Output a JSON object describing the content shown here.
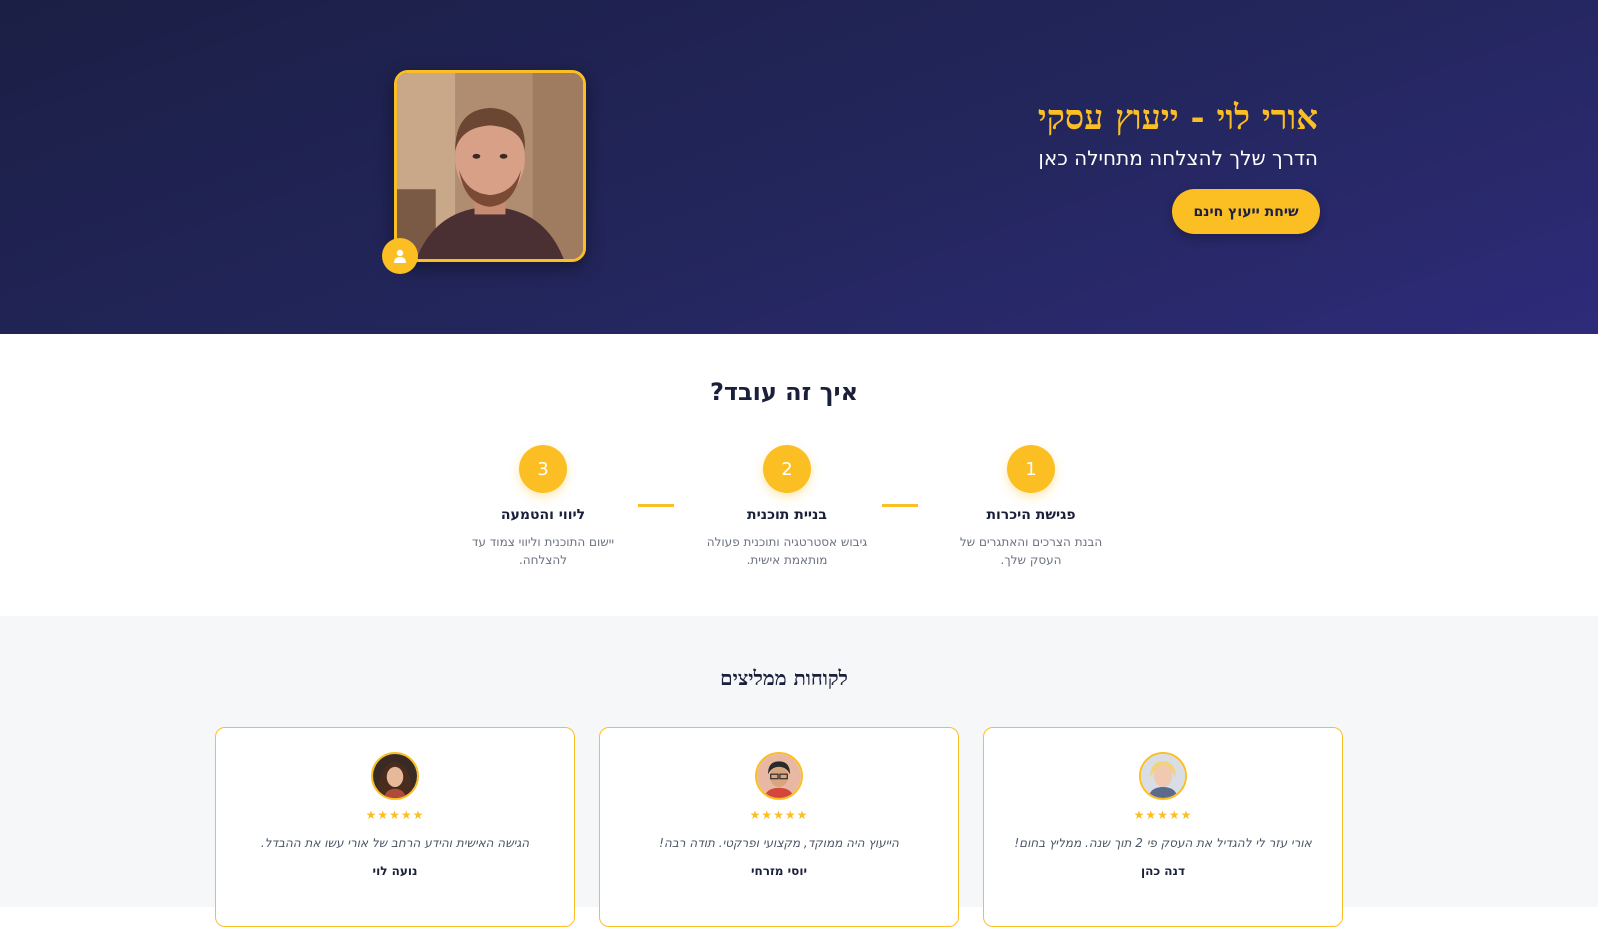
{
  "hero": {
    "title": "אורי לוי - ייעוץ עסקי",
    "subtitle": "הדרך שלך להצלחה מתחילה כאן",
    "cta_label": "שיחת ייעוץ חינם"
  },
  "how_it_works": {
    "title": "איך זה עובד?",
    "steps": [
      {
        "number": "1",
        "title": "פגישת היכרות",
        "description": "הבנת הצרכים והאתגרים של העסק שלך."
      },
      {
        "number": "2",
        "title": "בניית תוכנית",
        "description": "גיבוש אסטרטגיה ותוכנית פעולה מותאמת אישית."
      },
      {
        "number": "3",
        "title": "ליווי והטמעה",
        "description": "יישום התוכנית וליווי צמוד עד להצלחה."
      }
    ]
  },
  "testimonials": {
    "title": "לקוחות ממליצים",
    "items": [
      {
        "stars": "★★★★★",
        "quote": "אורי עזר לי להגדיל את העסק פי 2 תוך שנה. ממליץ בחום!",
        "name": "דנה כהן"
      },
      {
        "stars": "★★★★★",
        "quote": "הייעוץ היה ממוקד, מקצועי ופרקטי. תודה רבה!",
        "name": "יוסי מזרחי"
      },
      {
        "stars": "★★★★★",
        "quote": "הגישה האישית והידע הרחב של אורי עשו את ההבדל.",
        "name": "נועה לוי"
      }
    ]
  },
  "colors": {
    "accent": "#fbbf24",
    "hero_dark": "#1b1f45",
    "hero_light": "#2e2b7a"
  },
  "icons": {
    "profile_badge": "user-icon"
  }
}
